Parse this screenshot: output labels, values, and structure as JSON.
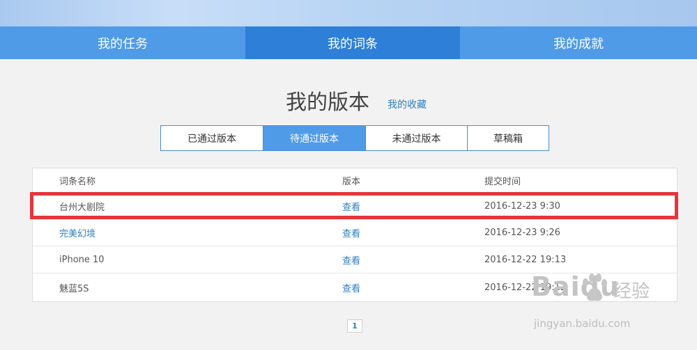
{
  "main_tabs": [
    {
      "label": "我的任务"
    },
    {
      "label": "我的词条"
    },
    {
      "label": "我的成就"
    }
  ],
  "page": {
    "title": "我的版本",
    "favorites_link": "我的收藏"
  },
  "sub_tabs": [
    {
      "label": "已通过版本"
    },
    {
      "label": "待通过版本"
    },
    {
      "label": "未通过版本"
    },
    {
      "label": "草稿箱"
    }
  ],
  "table": {
    "headers": {
      "name": "词条名称",
      "version": "版本",
      "time": "提交时间"
    },
    "rows": [
      {
        "name": "台州大剧院",
        "version": "查看",
        "time": "2016-12-23 9:30"
      },
      {
        "name": "完美幻境",
        "version": "查看",
        "time": "2016-12-23 9:26"
      },
      {
        "name": "iPhone 10",
        "version": "查看",
        "time": "2016-12-22 19:13"
      },
      {
        "name": "魅蓝5S",
        "version": "查看",
        "time": "2016-12-22 19:12"
      }
    ]
  },
  "pagination": {
    "current_page": "1"
  },
  "watermark": {
    "logo": "Baidu",
    "product": "经验",
    "url": "jingyan.baidu.com"
  },
  "colors": {
    "tab_bar": "#4f9be8",
    "tab_active": "#2e7fd8",
    "link": "#2f7fc4",
    "highlight": "#e5353b"
  }
}
